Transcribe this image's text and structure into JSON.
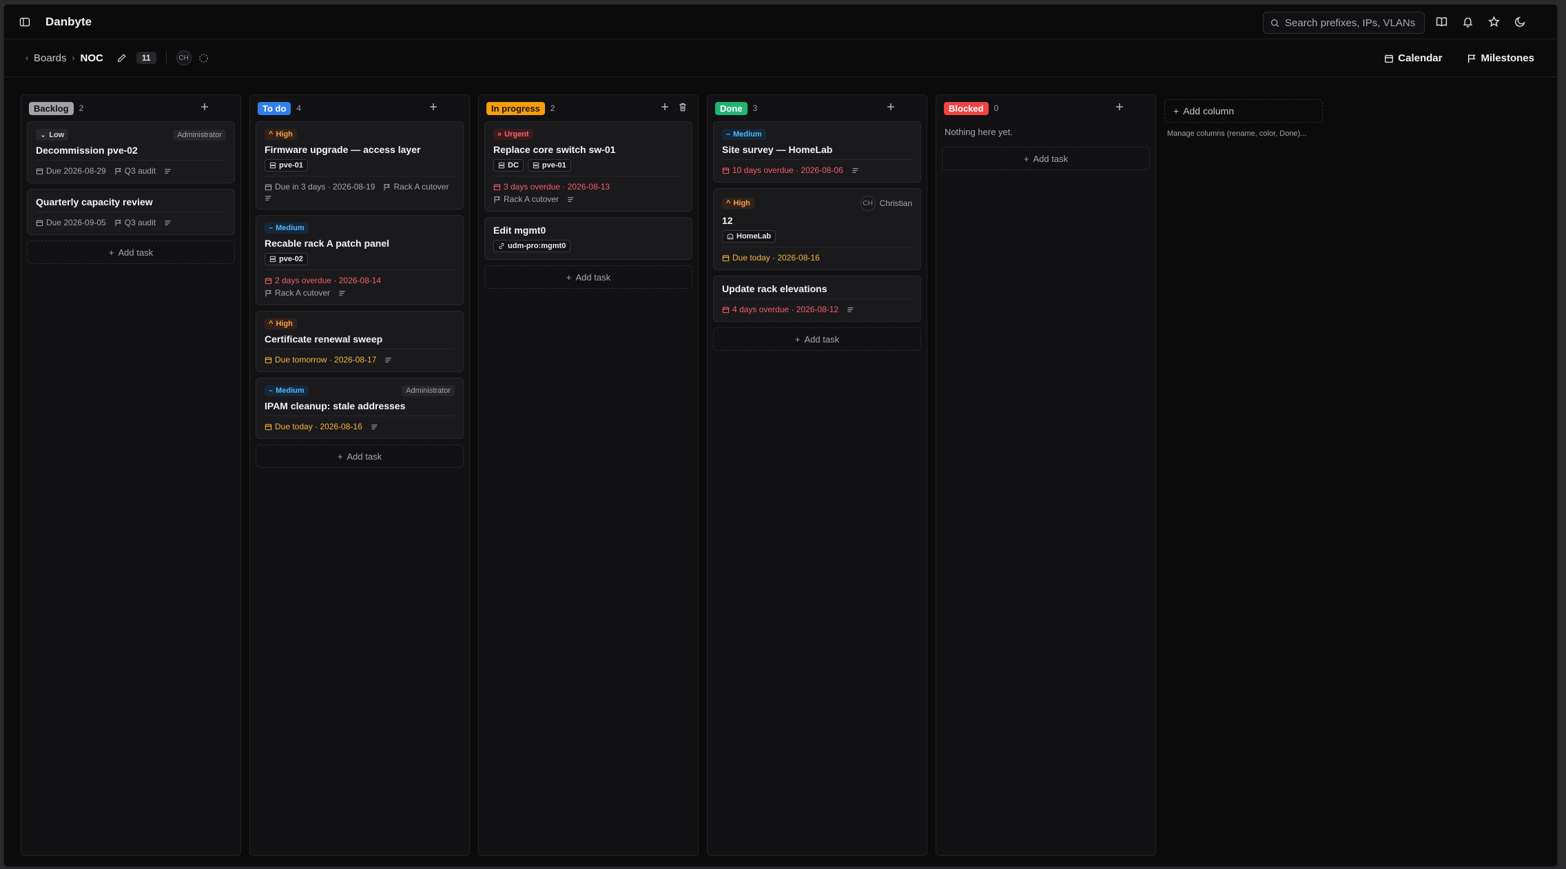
{
  "app": {
    "title": "Danbyte"
  },
  "search": {
    "placeholder": "Search prefixes, IPs, VLANs..."
  },
  "breadcrumb": {
    "boards": "Boards",
    "board": "NOC",
    "count": "11",
    "avatar": "CH"
  },
  "toolbar": {
    "calendar": "Calendar",
    "milestones": "Milestones"
  },
  "columns": [
    {
      "name": "Backlog",
      "count": "2",
      "color": "#a3a3a8",
      "cards": [
        {
          "priority": "Low",
          "assignee": "Administrator",
          "title": "Decommission pve-02",
          "due": "Due 2026-08-29",
          "milestone": "Q3 audit"
        },
        {
          "title": "Quarterly capacity review",
          "due": "Due 2026-09-05",
          "milestone": "Q3 audit"
        }
      ],
      "add_task": "Add task"
    },
    {
      "name": "To do",
      "count": "4",
      "color": "#2f80ed",
      "cards": [
        {
          "priority": "High",
          "title": "Firmware upgrade — access layer",
          "tags": [
            "pve-01"
          ],
          "due": "Due in 3 days · 2026-08-19",
          "milestone": "Rack A cutover"
        },
        {
          "priority": "Medium",
          "title": "Recable rack A patch panel",
          "tags": [
            "pve-02"
          ],
          "due": "2 days overdue · 2026-08-14",
          "milestone": "Rack A cutover"
        },
        {
          "priority": "High",
          "title": "Certificate renewal sweep",
          "due": "Due tomorrow · 2026-08-17"
        },
        {
          "priority": "Medium",
          "assignee": "Administrator",
          "title": "IPAM cleanup: stale addresses",
          "due": "Due today · 2026-08-16"
        }
      ],
      "add_task": "Add task"
    },
    {
      "name": "In progress",
      "count": "2",
      "color": "#f59e0b",
      "cards": [
        {
          "priority": "Urgent",
          "title": "Replace core switch sw-01",
          "tags": [
            "DC",
            "pve-01"
          ],
          "due": "3 days overdue · 2026-08-13",
          "milestone": "Rack A cutover"
        },
        {
          "title": "Edit mgmt0",
          "tags": [
            "udm-pro:mgmt0"
          ]
        }
      ],
      "add_task": "Add task"
    },
    {
      "name": "Done",
      "count": "3",
      "color": "#22b573",
      "cards": [
        {
          "priority": "Medium",
          "title": "Site survey — HomeLab",
          "due": "10 days overdue · 2026-08-06"
        },
        {
          "priority": "High",
          "assignee_initials": "CH",
          "assignee_name": "Christian",
          "title": "12",
          "tags": [
            "HomeLab"
          ],
          "due": "Due today · 2026-08-16"
        },
        {
          "title": "Update rack elevations",
          "due": "4 days overdue · 2026-08-12"
        }
      ],
      "add_task": "Add task"
    },
    {
      "name": "Blocked",
      "count": "0",
      "color": "#ef4444",
      "empty": "Nothing here yet.",
      "add_task": "Add task"
    }
  ],
  "add_column": {
    "label": "Add column",
    "note": "Manage columns (rename, color, Done)..."
  }
}
